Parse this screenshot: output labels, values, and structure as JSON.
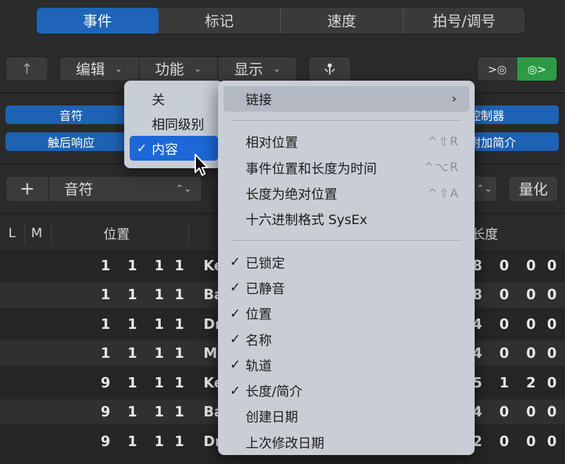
{
  "tabs": [
    {
      "label": "事件",
      "active": true
    },
    {
      "label": "标记",
      "active": false
    },
    {
      "label": "速度",
      "active": false
    },
    {
      "label": "拍号/调号",
      "active": false
    }
  ],
  "toolbar": {
    "up_icon": "↑",
    "edit_label": "编辑",
    "functions_label": "功能",
    "view_label": "显示",
    "chevron": "⌄",
    "catch_icon": "⸽ꞏ|ꞏ",
    "midi_in_icon": ">◎",
    "midi_out_icon": "◎>"
  },
  "filters": {
    "note": "音符",
    "aftertouch": "触后响应",
    "control": "控制器",
    "sysex_add": "附加简介"
  },
  "create": {
    "plus": "+",
    "type": "音符",
    "updown": "⌃⌄",
    "quantize": "量化"
  },
  "table": {
    "headers": {
      "l": "L",
      "m": "M",
      "position": "位置",
      "length": "长度"
    },
    "rows": [
      {
        "pos": "1 1 1",
        "tick": "1",
        "name": "Ke",
        "len": "8 0 0",
        "len2": "0"
      },
      {
        "pos": "1 1 1",
        "tick": "1",
        "name": "Ba",
        "len": "8 0 0",
        "len2": "0"
      },
      {
        "pos": "1 1 1",
        "tick": "1",
        "name": "Dr",
        "len": "4 0 0",
        "len2": "0"
      },
      {
        "pos": "1 1 1",
        "tick": "1",
        "name": "M",
        "len": "4 0 0",
        "len2": "0"
      },
      {
        "pos": "9 1 1",
        "tick": "1",
        "name": "Ke",
        "len": "5 1 2",
        "len2": "0"
      },
      {
        "pos": "9 1 1",
        "tick": "1",
        "name": "Ba",
        "len": "4 0 0",
        "len2": "0"
      },
      {
        "pos": "9 1 1",
        "tick": "1",
        "name": "Dr",
        "len": "2 0 0",
        "len2": "0"
      }
    ]
  },
  "link_popup": {
    "items": [
      {
        "label": "关",
        "checked": false,
        "selected": false
      },
      {
        "label": "相同级别",
        "checked": false,
        "selected": false
      },
      {
        "label": "内容",
        "checked": true,
        "selected": true
      }
    ]
  },
  "display_menu": {
    "link": {
      "label": "链接",
      "arrow": "›"
    },
    "group1": [
      {
        "label": "相对位置",
        "shortcut": "^⇧R"
      },
      {
        "label": "事件位置和长度为时间",
        "shortcut": "^⌥R"
      },
      {
        "label": "长度为绝对位置",
        "shortcut": "^⇧A"
      },
      {
        "label": "十六进制格式 SysEx",
        "shortcut": ""
      }
    ],
    "group2": [
      {
        "label": "已锁定",
        "checked": true
      },
      {
        "label": "已静音",
        "checked": true
      },
      {
        "label": "位置",
        "checked": true
      },
      {
        "label": "名称",
        "checked": true
      },
      {
        "label": "轨道",
        "checked": true
      },
      {
        "label": "长度/简介",
        "checked": true
      },
      {
        "label": "创建日期",
        "checked": false
      },
      {
        "label": "上次修改日期",
        "checked": false
      }
    ]
  },
  "check_glyph": "✓",
  "colors": {
    "accent_blue": "#1f64b8",
    "selected_blue": "#1c68d8",
    "midi_green": "#2e9a45",
    "menu_bg": "#c9ced5"
  }
}
